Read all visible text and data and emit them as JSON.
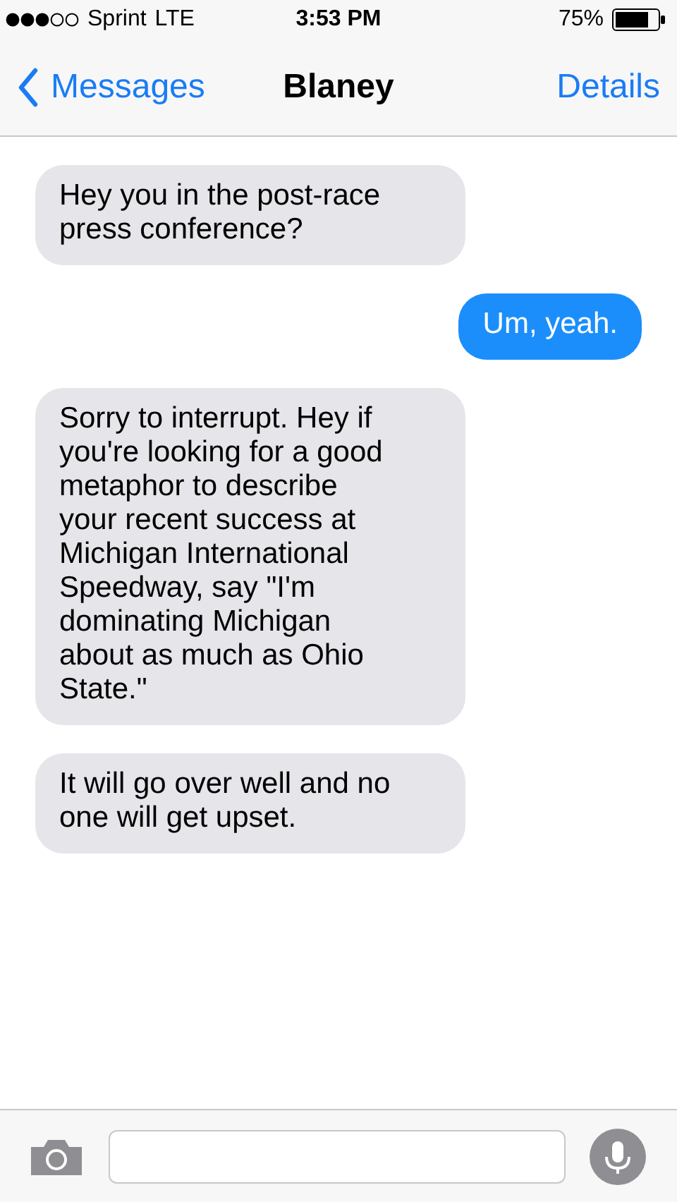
{
  "status_bar": {
    "carrier": "Sprint",
    "network": "LTE",
    "time": "3:53 PM",
    "battery": "75%"
  },
  "nav": {
    "back": "Messages",
    "title": "Blaney",
    "action": "Details"
  },
  "messages": [
    {
      "kind": "received",
      "text": "Hey you in the post-race press conference?"
    },
    {
      "kind": "sent",
      "text": "Um, yeah."
    },
    {
      "kind": "received",
      "text": "Sorry to interrupt. Hey if you're looking for a good metaphor to describe your recent success at Michigan International Speedway, say \"I'm dominating Michigan about as much as Ohio State.\""
    },
    {
      "kind": "received",
      "text": "It will go over well and no one will get upset."
    }
  ]
}
